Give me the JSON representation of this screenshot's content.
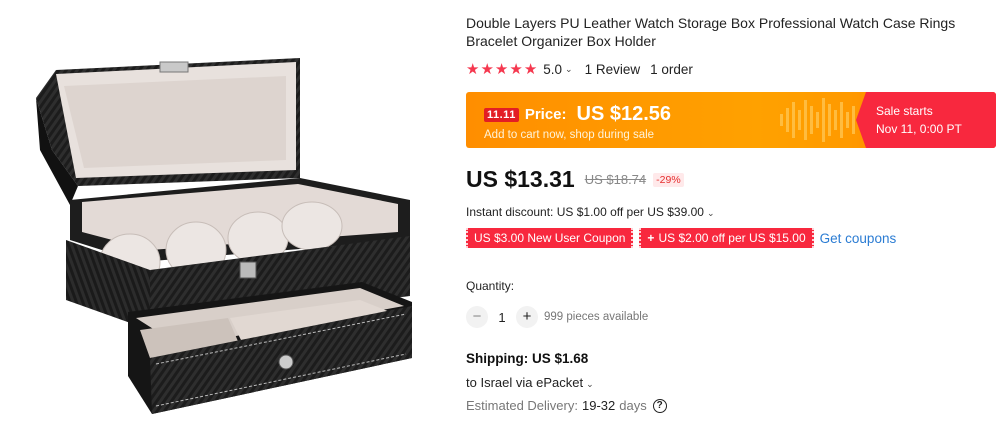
{
  "product": {
    "title": "Double Layers PU Leather Watch Storage Box Professional Watch Case Rings Bracelet Organizer Box Holder",
    "rating_value": "5.0",
    "reviews": "1 Review",
    "orders": "1 order",
    "stars": [
      "★",
      "★",
      "★",
      "★",
      "★"
    ]
  },
  "promo": {
    "badge": "11.11",
    "price_label": "Price:",
    "price": "US $12.56",
    "subtitle": "Add to cart now, shop during sale",
    "sale_starts": "Sale starts",
    "sale_date": "Nov 11, 0:00 PT"
  },
  "pricing": {
    "current": "US $13.31",
    "original": "US $18.74",
    "discount": "-29%",
    "instant_discount": "Instant discount: US $1.00 off per US $39.00"
  },
  "coupons": {
    "new_user": "US $3.00 New User Coupon",
    "store": "US $2.00 off per US $15.00",
    "store_prefix": "+",
    "get_coupons": "Get coupons"
  },
  "quantity": {
    "label": "Quantity:",
    "minus": "−",
    "value": "1",
    "plus": "+",
    "available": "999 pieces available"
  },
  "shipping": {
    "cost": "Shipping: US $1.68",
    "destination": "to Israel via ePacket",
    "delivery_label": "Estimated Delivery:",
    "delivery_days": "19-32",
    "delivery_unit": "days",
    "help": "?"
  },
  "icons": {
    "caret": "⌄"
  },
  "colors": {
    "accent_red": "#f8283e",
    "promo_orange": "#ffa100",
    "link_blue": "#2b7cd3"
  }
}
